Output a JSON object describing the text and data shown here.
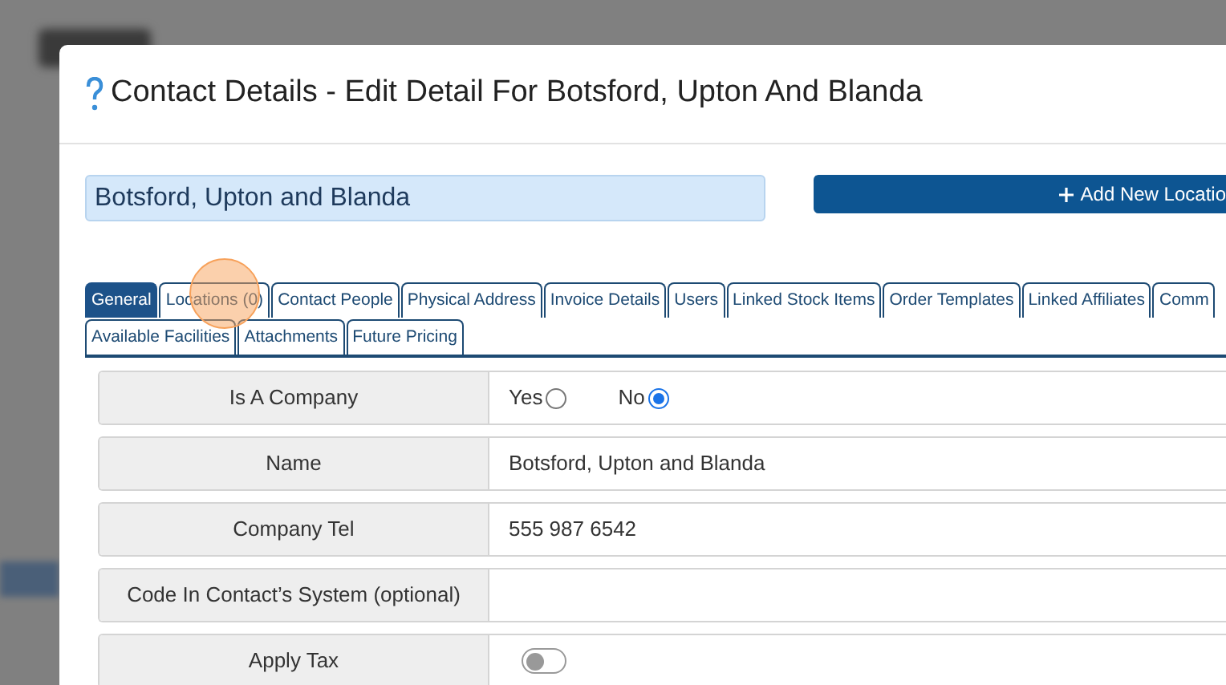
{
  "dialog": {
    "title": "Contact Details - Edit Detail For Botsford, Upton And Blanda"
  },
  "name_field": {
    "value": "Botsford, Upton and Blanda"
  },
  "add_button": {
    "label": "Add New Locatio"
  },
  "tab_rows": [
    [
      {
        "label": "General",
        "selected": true
      },
      {
        "label": "Locations (0)",
        "selected": false
      },
      {
        "label": "Contact People",
        "selected": false
      },
      {
        "label": "Physical Address",
        "selected": false
      },
      {
        "label": "Invoice Details",
        "selected": false
      },
      {
        "label": "Users",
        "selected": false
      },
      {
        "label": "Linked Stock Items",
        "selected": false
      },
      {
        "label": "Order Templates",
        "selected": false
      },
      {
        "label": "Linked Affiliates",
        "selected": false
      },
      {
        "label": "Comm",
        "selected": false
      }
    ],
    [
      {
        "label": "Available Facilities",
        "selected": false
      },
      {
        "label": "Attachments",
        "selected": false
      },
      {
        "label": "Future Pricing",
        "selected": false
      }
    ]
  ],
  "form_rows": [
    {
      "kind": "radio",
      "label": "Is A Company",
      "options": [
        {
          "label": "Yes",
          "selected": false
        },
        {
          "label": "No",
          "selected": true
        }
      ]
    },
    {
      "kind": "text",
      "label": "Name",
      "value": "Botsford, Upton and Blanda"
    },
    {
      "kind": "text",
      "label": "Company Tel",
      "value": "555 987 6542"
    },
    {
      "kind": "text",
      "label": "Code In Contact’s System (optional)"
    },
    {
      "kind": "toggle",
      "label": "Apply Tax",
      "on": false
    }
  ]
}
